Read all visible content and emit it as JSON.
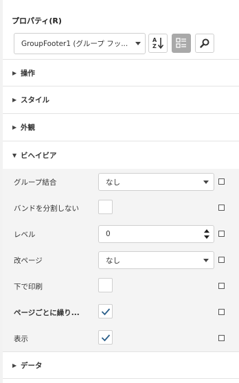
{
  "panel": {
    "title": "プロパティ(R)",
    "object_selector": {
      "value": "GroupFooter1 (グループ フッ..."
    }
  },
  "toolbar": {
    "sort_icon": "sort-az-icon",
    "categorized_icon": "categorized-view-icon",
    "search_icon": "search-icon"
  },
  "sections": {
    "action": "操作",
    "style": "スタイル",
    "appearance": "外観",
    "behavior": "ビヘイビア",
    "data": "データ"
  },
  "properties": [
    {
      "label": "グループ結合",
      "type": "combo",
      "value": "なし"
    },
    {
      "label": "バンドを分割しない",
      "type": "checkbox",
      "checked": false
    },
    {
      "label": "レベル",
      "type": "number",
      "value": "0"
    },
    {
      "label": "改ページ",
      "type": "combo",
      "value": "なし"
    },
    {
      "label": "下で印刷",
      "type": "checkbox",
      "checked": false
    },
    {
      "label": "ページごとに繰り...",
      "type": "checkbox",
      "checked": true
    },
    {
      "label": "表示",
      "type": "checkbox",
      "checked": true
    }
  ],
  "colors": {
    "accent": "#2a5f8a",
    "active_button": "#a9a9a9",
    "property_bg": "#f4f4f4"
  }
}
